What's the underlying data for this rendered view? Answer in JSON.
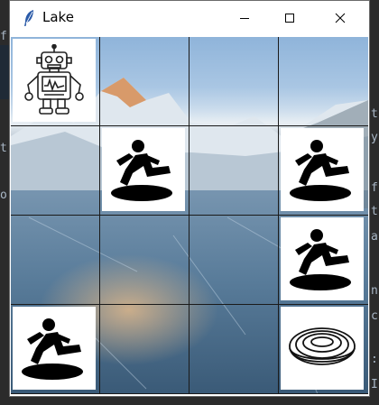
{
  "window": {
    "title": "Lake",
    "controls": {
      "minimize": "minimize",
      "maximize": "maximize",
      "close": "close"
    }
  },
  "background_peek": {
    "left_chars": [
      "f",
      "t.",
      "o"
    ],
    "right_chars": [
      "t",
      "y",
      "f",
      "t",
      "a",
      "n",
      "c",
      ":",
      "I"
    ]
  },
  "board": {
    "rows": 4,
    "cols": 4,
    "cells": [
      [
        "robot",
        "ice",
        "ice",
        "ice"
      ],
      [
        "ice",
        "hole",
        "ice",
        "hole"
      ],
      [
        "ice",
        "ice",
        "ice",
        "hole"
      ],
      [
        "hole",
        "ice",
        "ice",
        "goal"
      ]
    ]
  },
  "icons": {
    "robot": "robot-icon",
    "hole": "falling-person-hole-icon",
    "goal": "frisbee-icon"
  }
}
